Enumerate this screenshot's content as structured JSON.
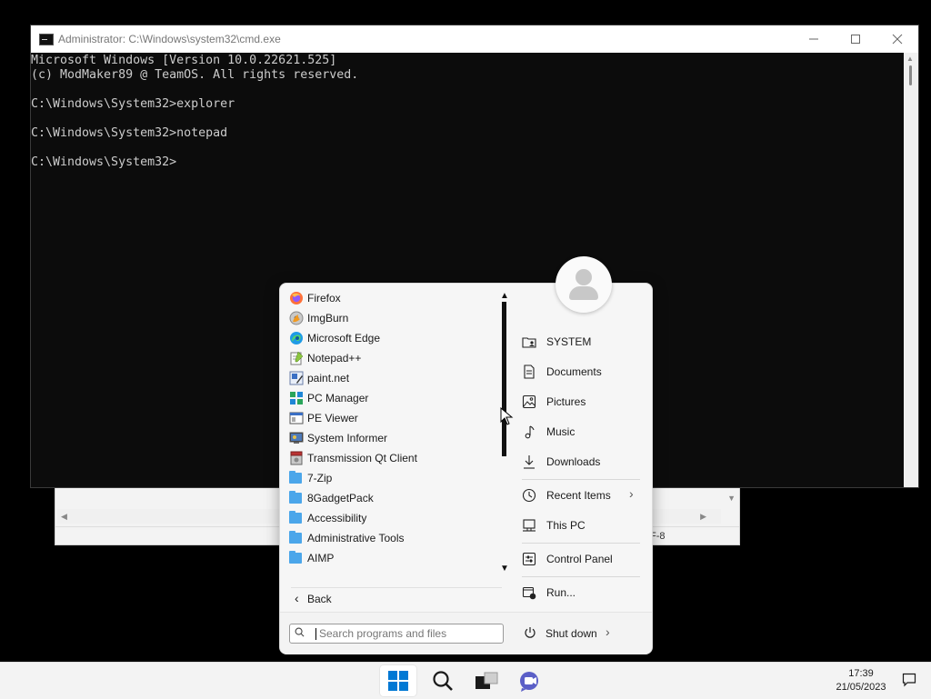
{
  "cmd_window": {
    "title": "Administrator: C:\\Windows\\system32\\cmd.exe",
    "minimize_icon": "minimize-icon",
    "maximize_icon": "maximize-icon",
    "close_icon": "close-icon",
    "lines": [
      "Microsoft Windows [Version 10.0.22621.525]",
      "(c) ModMaker89 @ TeamOS. All rights reserved.",
      "",
      "C:\\Windows\\System32>explorer",
      "",
      "C:\\Windows\\System32>notepad",
      "",
      "C:\\Windows\\System32>"
    ]
  },
  "notepad": {
    "status_encoding": "F-8"
  },
  "start_menu": {
    "programs": [
      {
        "label": "Firefox",
        "icon": "firefox-icon"
      },
      {
        "label": "ImgBurn",
        "icon": "imgburn-icon"
      },
      {
        "label": "Microsoft Edge",
        "icon": "edge-icon"
      },
      {
        "label": "Notepad++",
        "icon": "notepadpp-icon"
      },
      {
        "label": "paint.net",
        "icon": "paintnet-icon"
      },
      {
        "label": "PC Manager",
        "icon": "pc-manager-icon"
      },
      {
        "label": "PE Viewer",
        "icon": "pe-viewer-icon"
      },
      {
        "label": "System Informer",
        "icon": "system-informer-icon"
      },
      {
        "label": "Transmission Qt Client",
        "icon": "transmission-icon"
      },
      {
        "label": "7-Zip",
        "icon": "folder-icon"
      },
      {
        "label": "8GadgetPack",
        "icon": "folder-icon"
      },
      {
        "label": "Accessibility",
        "icon": "folder-icon"
      },
      {
        "label": "Administrative Tools",
        "icon": "folder-icon"
      },
      {
        "label": "AIMP",
        "icon": "folder-icon"
      }
    ],
    "back_label": "Back",
    "search_placeholder": "Search programs and files",
    "shutdown_label": "Shut down",
    "right_items": [
      {
        "label": "SYSTEM",
        "icon": "user-folder-icon"
      },
      {
        "label": "Documents",
        "icon": "document-icon"
      },
      {
        "label": "Pictures",
        "icon": "pictures-icon"
      },
      {
        "label": "Music",
        "icon": "music-icon"
      },
      {
        "label": "Downloads",
        "icon": "downloads-icon"
      },
      {
        "label": "Recent Items",
        "icon": "recent-icon"
      },
      {
        "label": "This PC",
        "icon": "this-pc-icon"
      },
      {
        "label": "Control Panel",
        "icon": "control-panel-icon"
      },
      {
        "label": "Run...",
        "icon": "run-icon"
      }
    ]
  },
  "taskbar": {
    "time": "17:39",
    "date": "21/05/2023",
    "buttons": [
      "start-icon",
      "search-icon",
      "task-view-icon",
      "chat-icon"
    ]
  },
  "colors": {
    "folder": "#4ba6ea",
    "windows_blue": "#0078d4",
    "cmd_bg": "#0c0c0c",
    "cmd_text": "#cccccc"
  }
}
